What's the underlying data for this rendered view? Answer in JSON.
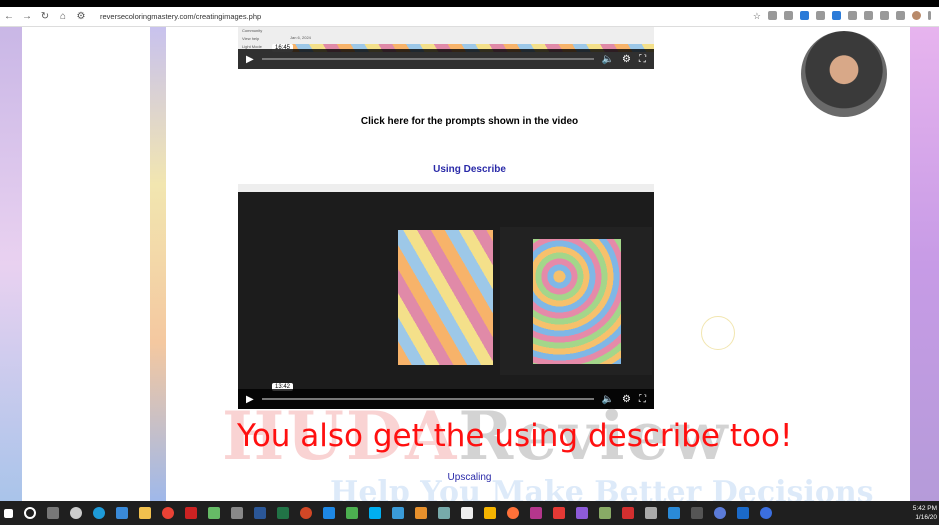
{
  "browser": {
    "url": "reversecoloringmastery.com/creatingimages.php"
  },
  "video1": {
    "timestamp": "16:45",
    "sidebar_items": [
      "Community",
      "View help",
      "Light Mode"
    ],
    "date": "Jan 6, 2024"
  },
  "prompts_link": "Click here for the prompts shown in the video",
  "section1_title": "Using Describe",
  "video2": {
    "timestamp": "13:42"
  },
  "caption": "You also get the using describe too!",
  "watermark": {
    "brand": "HUDAReview",
    "tagline": "Help You Make Better Decisions"
  },
  "section2_title": "Upscaling",
  "taskbar": {
    "time": "5:42 PM",
    "date": "1/16/20"
  },
  "colors": {
    "caption": "#ff1010",
    "section_title": "#2a2aa8"
  }
}
